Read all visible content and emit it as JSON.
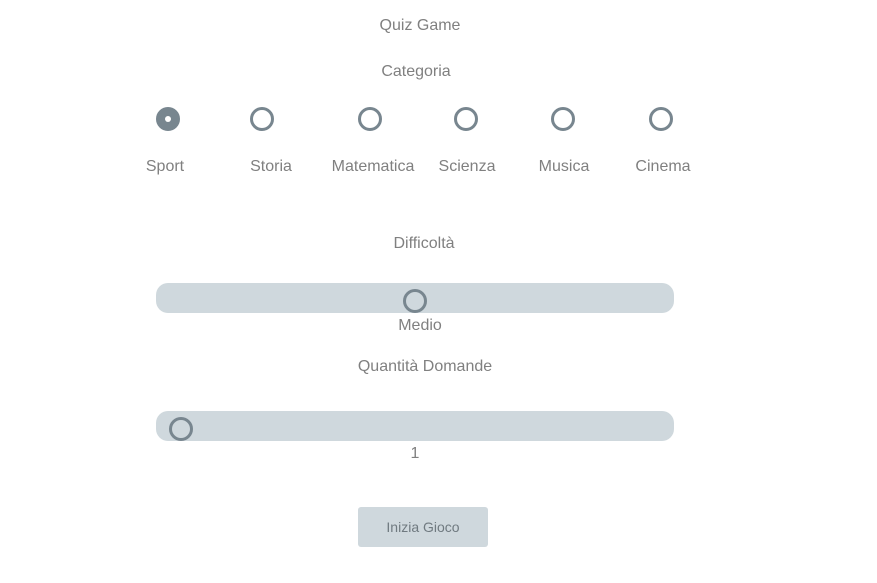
{
  "title": "Quiz Game",
  "category": {
    "heading": "Categoria",
    "options": [
      {
        "label": "Sport",
        "checked": true
      },
      {
        "label": "Storia",
        "checked": false
      },
      {
        "label": "Matematica",
        "checked": false
      },
      {
        "label": "Scienza",
        "checked": false
      },
      {
        "label": "Musica",
        "checked": false
      },
      {
        "label": "Cinema",
        "checked": false
      }
    ]
  },
  "difficulty": {
    "heading": "Difficoltà",
    "value_label": "Medio",
    "level_fraction": 0.5
  },
  "question_count": {
    "heading": "Quantità Domande",
    "value": "1",
    "level_fraction": 0.0
  },
  "start_button": {
    "label": "Inizia Gioco"
  },
  "colors": {
    "text": "#808080",
    "accent": "#78868f",
    "track": "#cfd8dd"
  }
}
